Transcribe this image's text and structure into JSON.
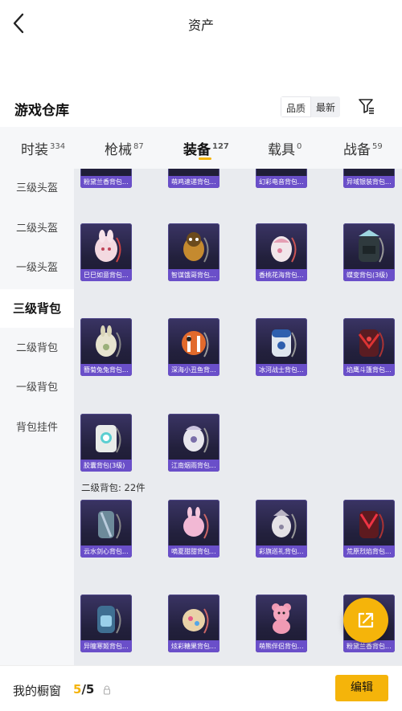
{
  "header": {
    "title": "资产"
  },
  "warehouse": {
    "title": "游戏仓库",
    "sort_options": [
      "品质",
      "最新"
    ]
  },
  "tabs": [
    {
      "label": "时装",
      "count": "334"
    },
    {
      "label": "枪械",
      "count": "87"
    },
    {
      "label": "装备",
      "count": "127"
    },
    {
      "label": "载具",
      "count": "0"
    },
    {
      "label": "战备",
      "count": "59"
    }
  ],
  "sidebar": {
    "items": [
      "三级头盔",
      "二级头盔",
      "一级头盔",
      "三级背包",
      "二级背包",
      "一级背包",
      "背包挂件"
    ]
  },
  "grid": {
    "top_row": [
      "粉黛兰香背包...",
      "萌鸡速递背包...",
      "幻彩电音背包...",
      "异域银装背包..."
    ],
    "level3": [
      "巳巳如意背包...",
      "智谋饿哥背包...",
      "香桃花海背包...",
      "蝶变背包(3级)",
      "簪菊兔兔背包...",
      "深海小丑鱼背...",
      "冰河战士背包...",
      "焰鹰斗篷背包...",
      "胶囊背包(3级)",
      "江南烟雨背包..."
    ],
    "section_label": "二级背包: 22件",
    "level2": [
      "云水剑心背包...",
      "嘀夏甜甜背包...",
      "彩旗巡礼背包...",
      "荒原烈焰背包...",
      "异瞳寒姬背包...",
      "炫彩糖果背包...",
      "萌熊伴侣背包...",
      "粉黛兰香背包..."
    ]
  },
  "bottom": {
    "showcase_label": "我的橱窗",
    "current": "5",
    "total": "/5",
    "edit_label": "编辑"
  },
  "colors": {
    "accent": "#f5b40a",
    "card_label": "#6a4fc9",
    "card_bg": "#2a2648"
  }
}
